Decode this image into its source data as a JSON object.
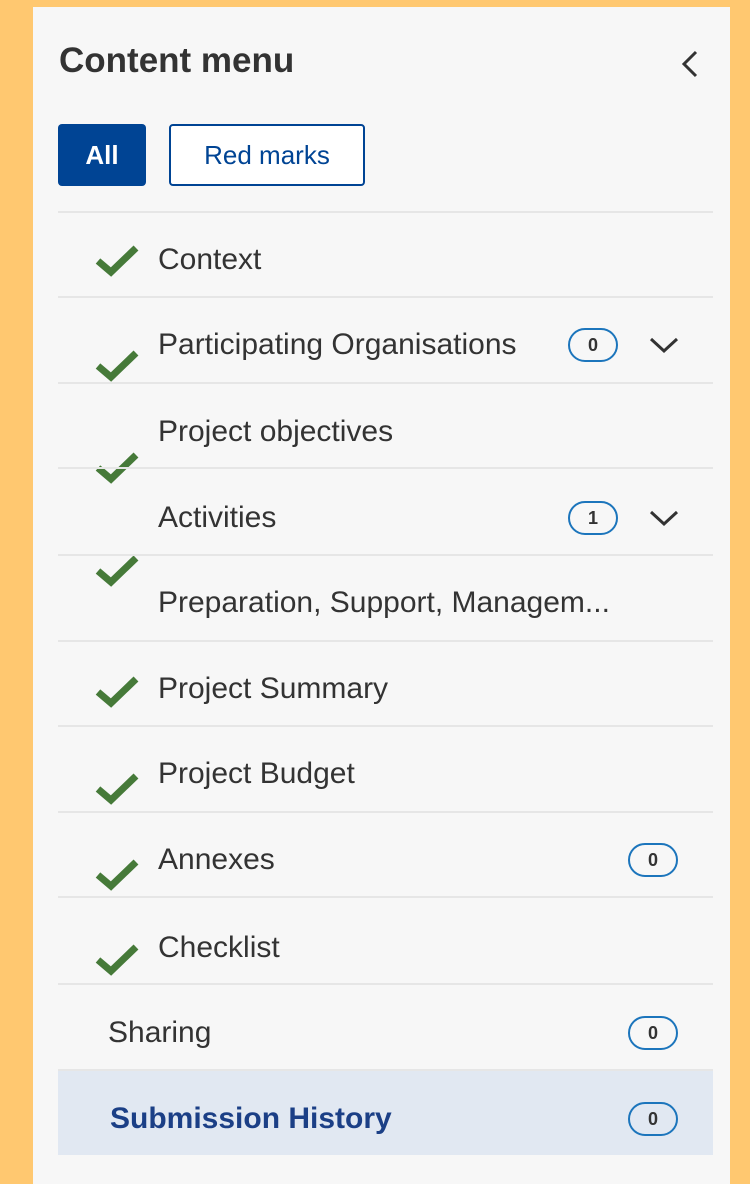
{
  "panel": {
    "title": "Content menu",
    "collapse_icon": "chevron-left-icon"
  },
  "filters": {
    "all_label": "All",
    "red_marks_label": "Red marks"
  },
  "colors": {
    "primary": "#004494",
    "check": "#467a39",
    "badge_border": "#1c75bc",
    "active_bg": "#e1e8f2",
    "page_bg": "#ffc870"
  },
  "menu": [
    {
      "label": "Context",
      "done": true
    },
    {
      "label": "Participating Organisations",
      "done": true,
      "badge": "0",
      "expandable": true
    },
    {
      "label": "Project objectives",
      "done": true
    },
    {
      "label": "Activities",
      "done": true,
      "badge": "1",
      "expandable": true
    },
    {
      "label": "Preparation, Support, Managem...",
      "done": true
    },
    {
      "label": "Project Summary",
      "done": true
    },
    {
      "label": "Project Budget",
      "done": true
    },
    {
      "label": "Annexes",
      "done": true,
      "badge": "0"
    },
    {
      "label": "Checklist",
      "done": true
    },
    {
      "label": "Sharing",
      "done": false,
      "badge": "0"
    },
    {
      "label": "Submission History",
      "done": false,
      "badge": "0",
      "active": true
    }
  ]
}
